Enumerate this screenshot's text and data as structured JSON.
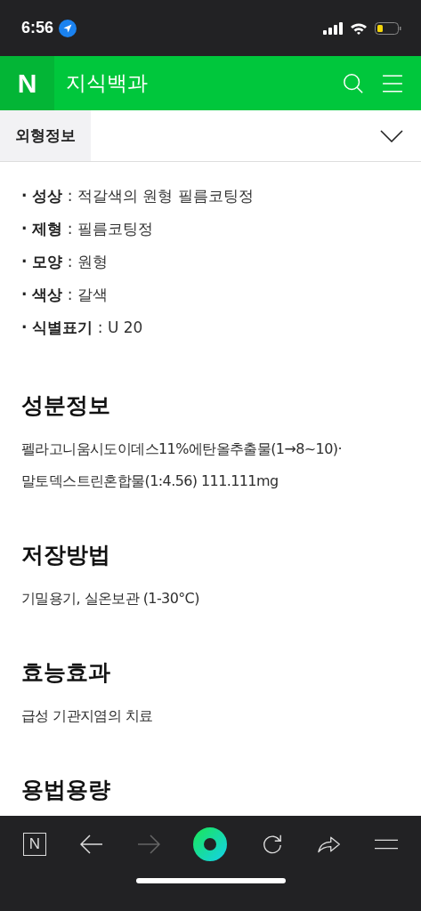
{
  "status_bar": {
    "time": "6:56"
  },
  "header": {
    "logo": "N",
    "title": "지식백과"
  },
  "section_tab": {
    "label": "외형정보",
    "expanded": false
  },
  "appearance": [
    "**· 성상** : 적갈색의 원형 필름코팅정",
    "**· 제형** : 필름코팅정",
    "**· 모양** : 원형",
    "**· 색상** : 갈색",
    "**· 식별표기** : U 20"
  ],
  "sections": [
    {
      "heading": "성분정보",
      "lines": [
        "펠라고니움시도이데스11%에탄올추출물(1→8~10)·",
        "말토덱스트린혼합물(1:4.56) 111.111mg"
      ]
    },
    {
      "heading": "저장방법",
      "lines": [
        "기밀용기, 실온보관 (1-30°C)"
      ]
    },
    {
      "heading": "효능효과",
      "lines": [
        "급성 기관지염의 치료"
      ]
    },
    {
      "heading": "용법용량"
    }
  ],
  "toolbar": [
    {
      "kind": "home",
      "label": "N",
      "disabled": false
    },
    {
      "kind": "back",
      "disabled": false
    },
    {
      "kind": "forward",
      "disabled": true
    },
    {
      "kind": "green",
      "disabled": false
    },
    {
      "kind": "reload",
      "disabled": false
    },
    {
      "kind": "share",
      "disabled": false
    },
    {
      "kind": "menu",
      "disabled": false
    }
  ]
}
